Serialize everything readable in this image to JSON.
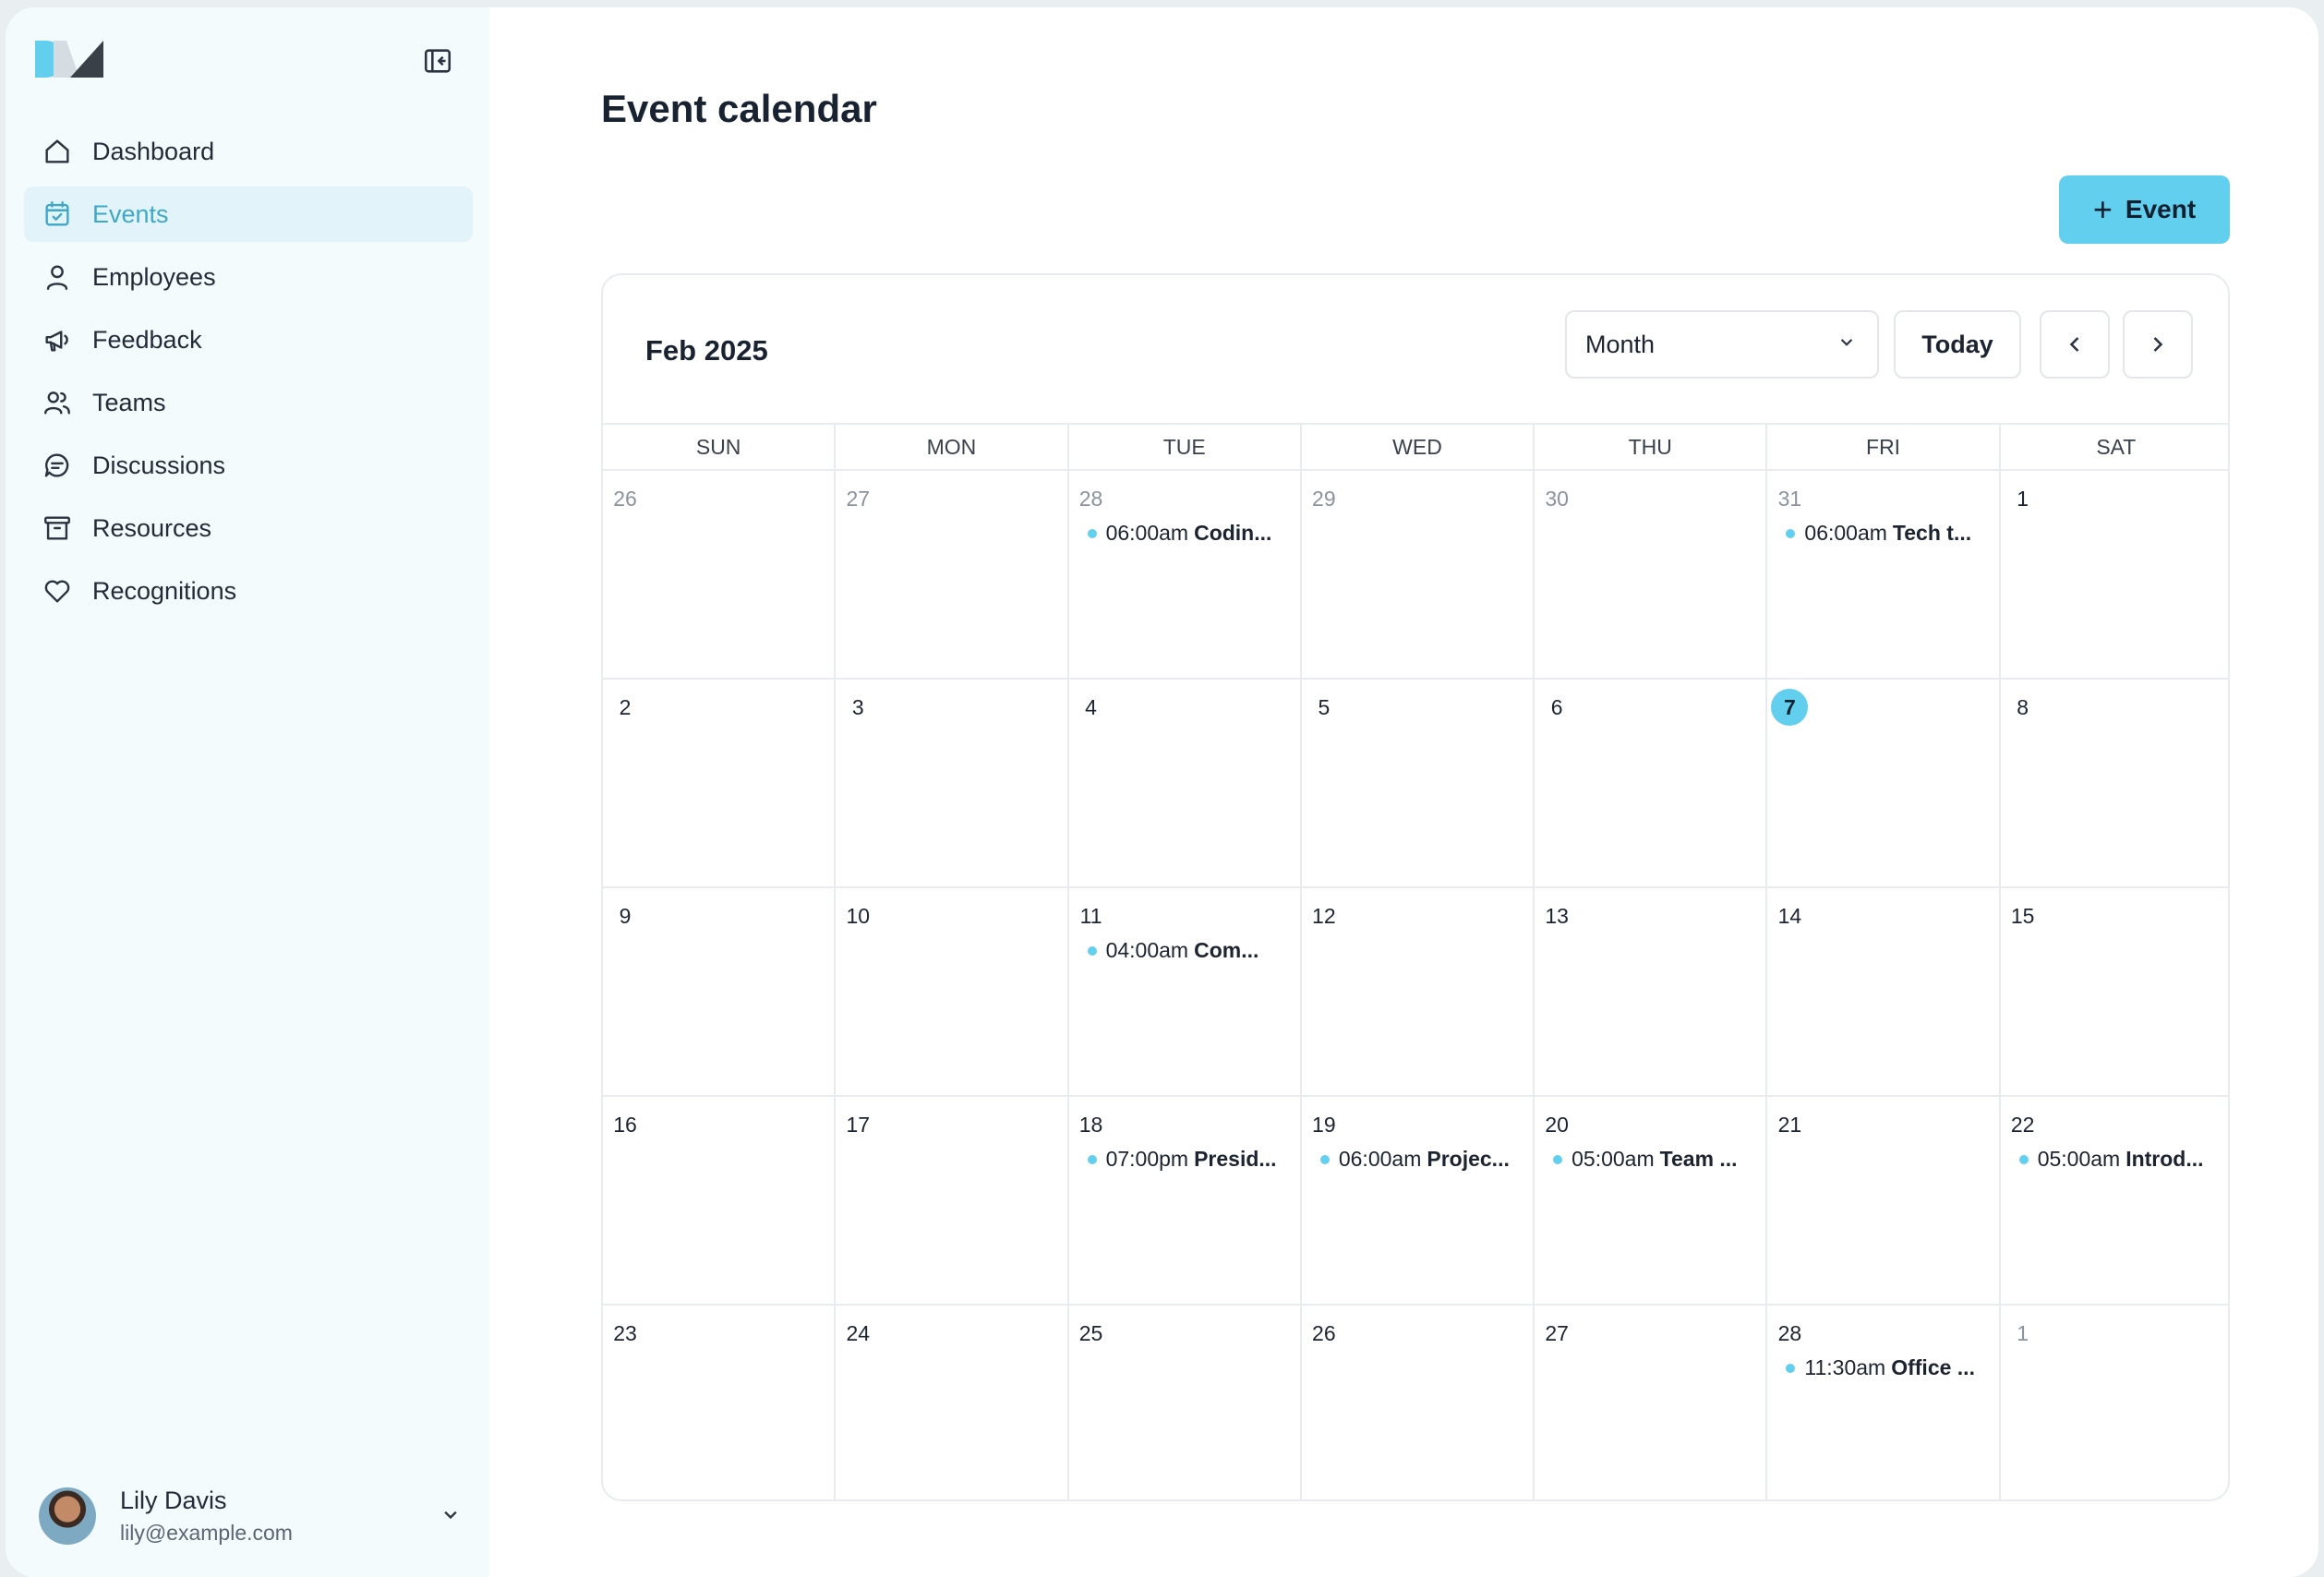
{
  "colors": {
    "accent": "#63cfee",
    "active_text": "#3fa8c9",
    "sidebar_bg": "#f4fbfd"
  },
  "sidebar": {
    "items": [
      {
        "label": "Dashboard",
        "icon": "home-icon"
      },
      {
        "label": "Events",
        "icon": "calendar-check-icon",
        "active": true
      },
      {
        "label": "Employees",
        "icon": "user-icon"
      },
      {
        "label": "Feedback",
        "icon": "megaphone-icon"
      },
      {
        "label": "Teams",
        "icon": "users-icon"
      },
      {
        "label": "Discussions",
        "icon": "chat-icon"
      },
      {
        "label": "Resources",
        "icon": "archive-icon"
      },
      {
        "label": "Recognitions",
        "icon": "heart-icon"
      }
    ],
    "user": {
      "name": "Lily Davis",
      "email": "lily@example.com"
    }
  },
  "header": {
    "title": "Event calendar",
    "add_button_label": "Event"
  },
  "calendar": {
    "month_label": "Feb 2025",
    "view": "Month",
    "today_label": "Today",
    "weekdays": [
      "SUN",
      "MON",
      "TUE",
      "WED",
      "THU",
      "FRI",
      "SAT"
    ],
    "weeks": [
      [
        {
          "day": "26",
          "muted": true
        },
        {
          "day": "27",
          "muted": true
        },
        {
          "day": "28",
          "muted": true,
          "events": [
            {
              "time": "06:00am",
              "title": "Codin..."
            }
          ]
        },
        {
          "day": "29",
          "muted": true
        },
        {
          "day": "30",
          "muted": true
        },
        {
          "day": "31",
          "muted": true,
          "events": [
            {
              "time": "06:00am",
              "title": "Tech t..."
            }
          ]
        },
        {
          "day": "1"
        }
      ],
      [
        {
          "day": "2"
        },
        {
          "day": "3"
        },
        {
          "day": "4"
        },
        {
          "day": "5"
        },
        {
          "day": "6"
        },
        {
          "day": "7",
          "today": true
        },
        {
          "day": "8"
        }
      ],
      [
        {
          "day": "9"
        },
        {
          "day": "10"
        },
        {
          "day": "11",
          "events": [
            {
              "time": "04:00am",
              "title": "Com..."
            }
          ]
        },
        {
          "day": "12"
        },
        {
          "day": "13"
        },
        {
          "day": "14"
        },
        {
          "day": "15"
        }
      ],
      [
        {
          "day": "16"
        },
        {
          "day": "17"
        },
        {
          "day": "18",
          "events": [
            {
              "time": "07:00pm",
              "title": "Presid..."
            }
          ]
        },
        {
          "day": "19",
          "events": [
            {
              "time": "06:00am",
              "title": "Projec..."
            }
          ]
        },
        {
          "day": "20",
          "events": [
            {
              "time": "05:00am",
              "title": "Team ..."
            }
          ]
        },
        {
          "day": "21"
        },
        {
          "day": "22",
          "events": [
            {
              "time": "05:00am",
              "title": "Introd..."
            }
          ]
        }
      ],
      [
        {
          "day": "23"
        },
        {
          "day": "24"
        },
        {
          "day": "25"
        },
        {
          "day": "26"
        },
        {
          "day": "27"
        },
        {
          "day": "28",
          "events": [
            {
              "time": "11:30am",
              "title": "Office ..."
            }
          ]
        },
        {
          "day": "1",
          "muted": true
        }
      ]
    ]
  }
}
